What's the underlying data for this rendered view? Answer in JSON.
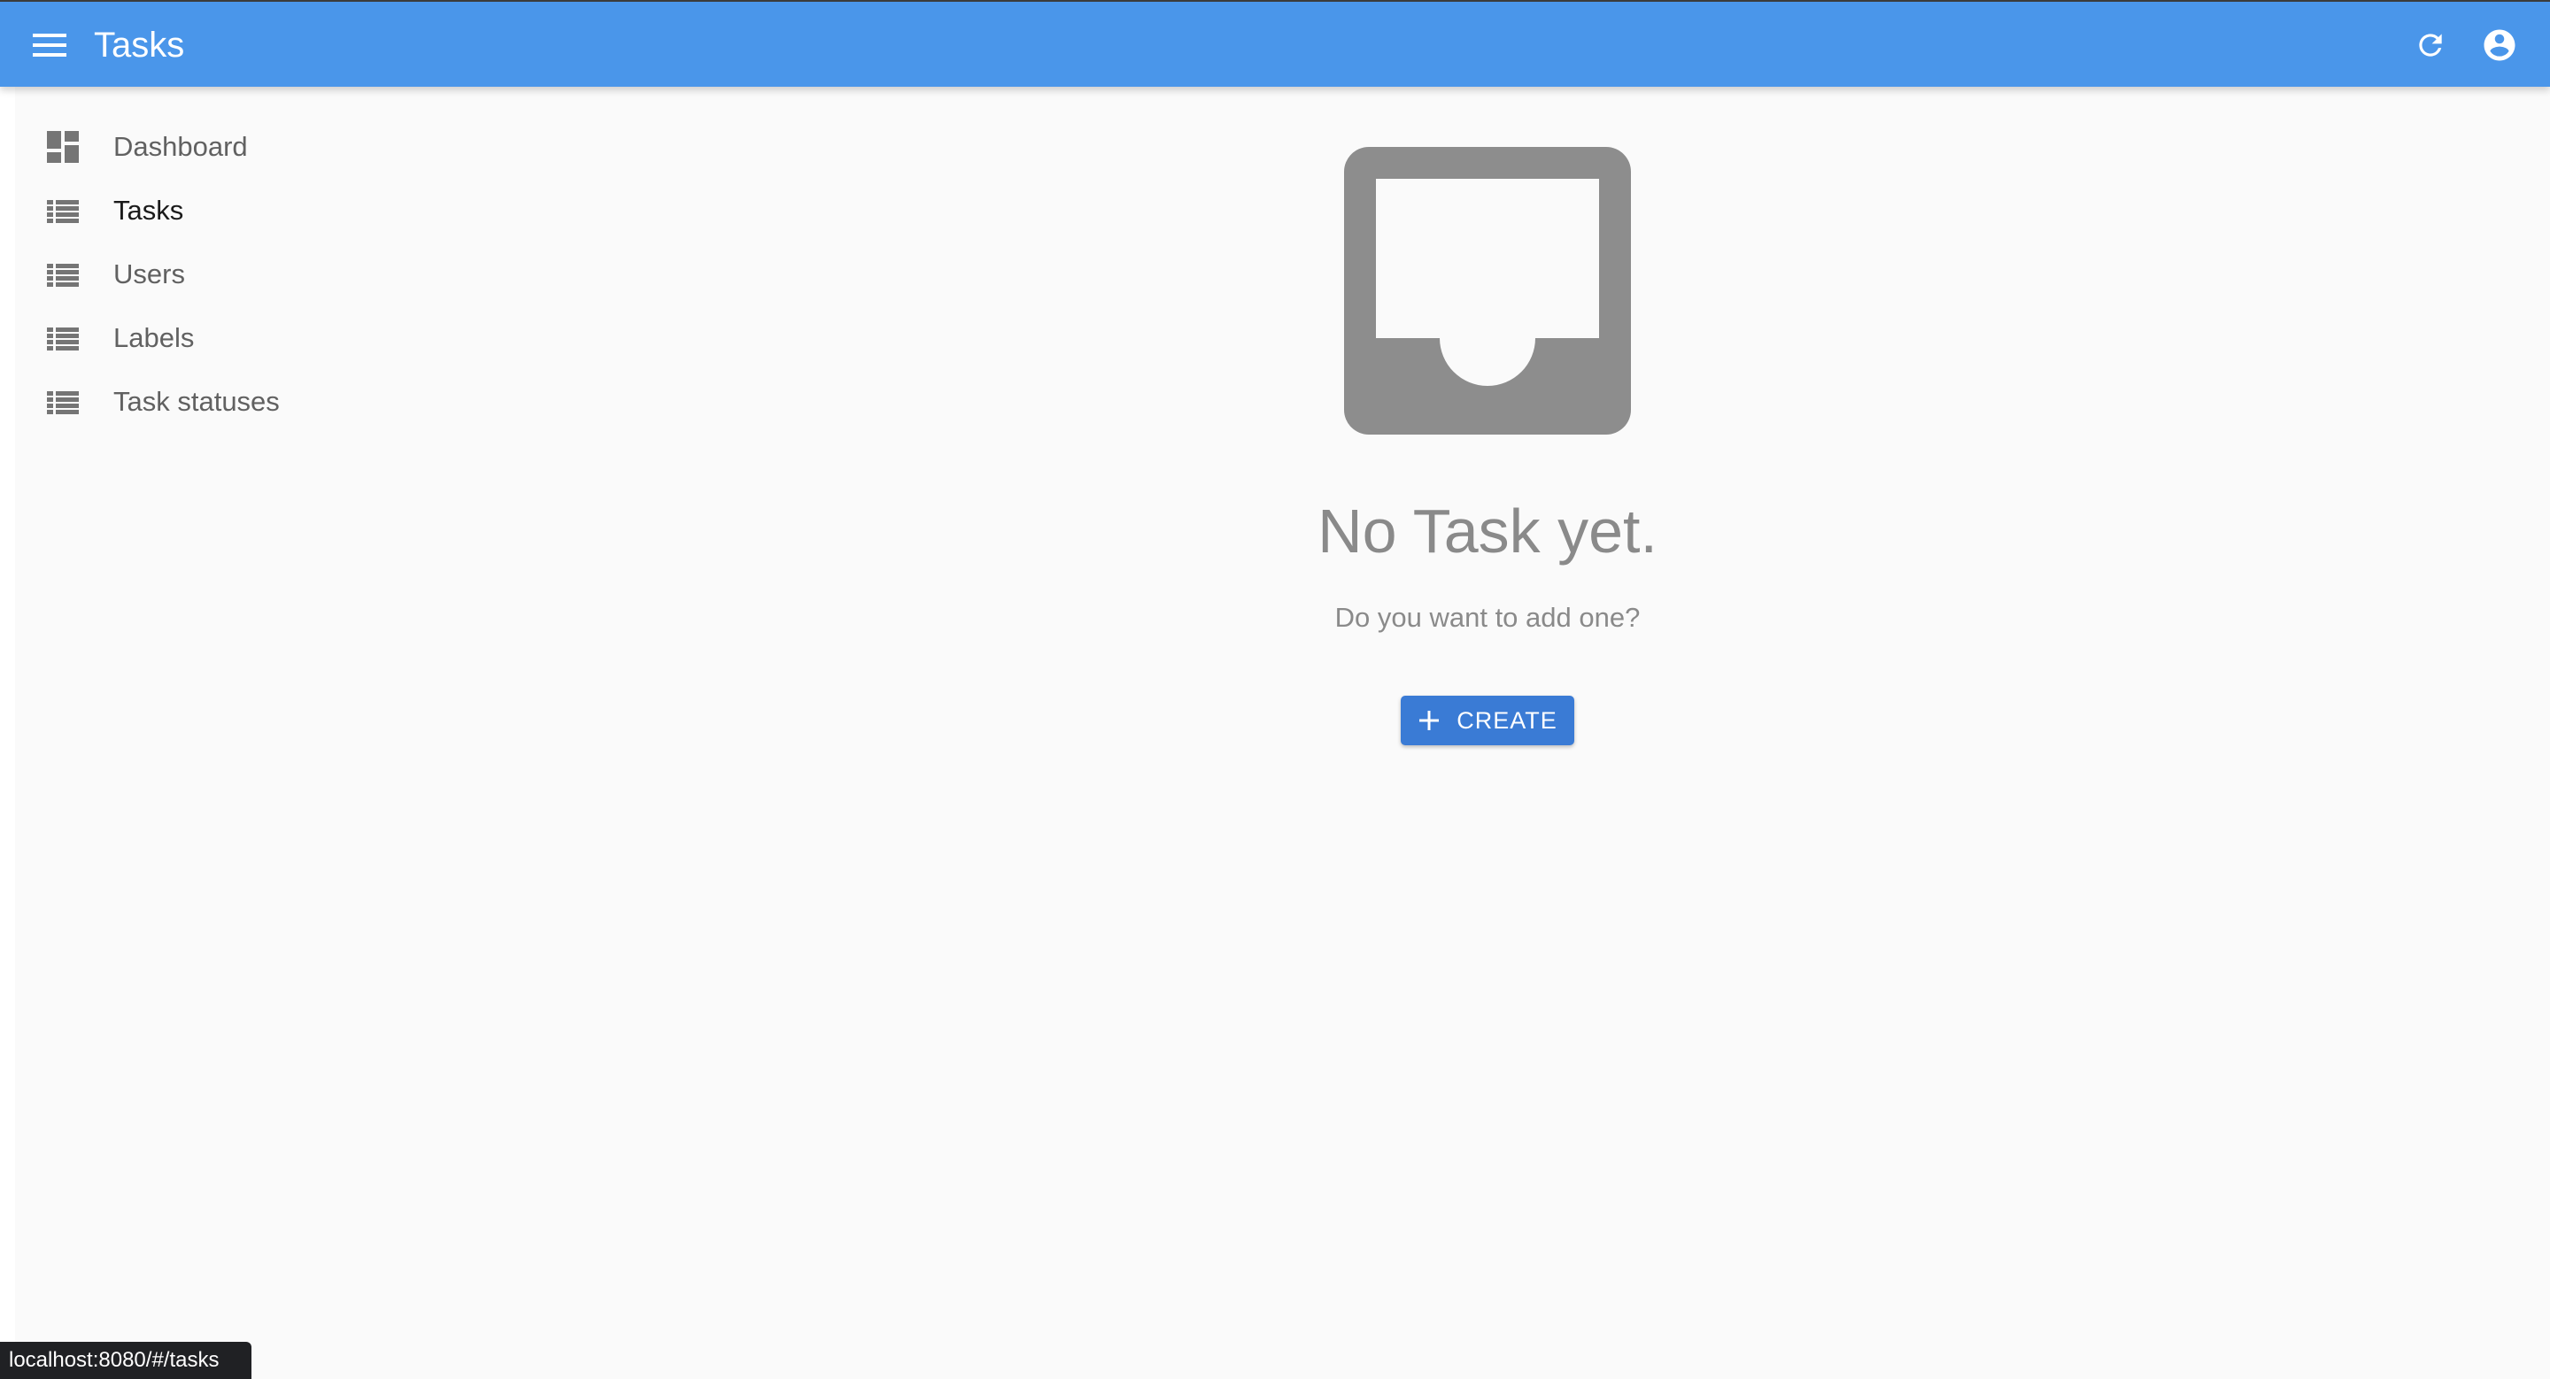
{
  "appbar": {
    "title": "Tasks",
    "menu_icon": "menu-icon",
    "refresh_icon": "refresh-icon",
    "account_icon": "account-circle-icon",
    "color": "#4a96ea"
  },
  "sidebar": {
    "items": [
      {
        "label": "Dashboard",
        "icon": "dashboard-icon",
        "active": false
      },
      {
        "label": "Tasks",
        "icon": "list-icon",
        "active": true
      },
      {
        "label": "Users",
        "icon": "list-icon",
        "active": false
      },
      {
        "label": "Labels",
        "icon": "list-icon",
        "active": false
      },
      {
        "label": "Task statuses",
        "icon": "list-icon",
        "active": false
      }
    ]
  },
  "empty_state": {
    "icon": "inbox-icon",
    "title": "No Task yet.",
    "subtitle": "Do you want to add one?",
    "create_label": "CREATE",
    "button_color": "#3a7bd5"
  },
  "status_bar": {
    "url": "localhost:8080/#/tasks"
  }
}
